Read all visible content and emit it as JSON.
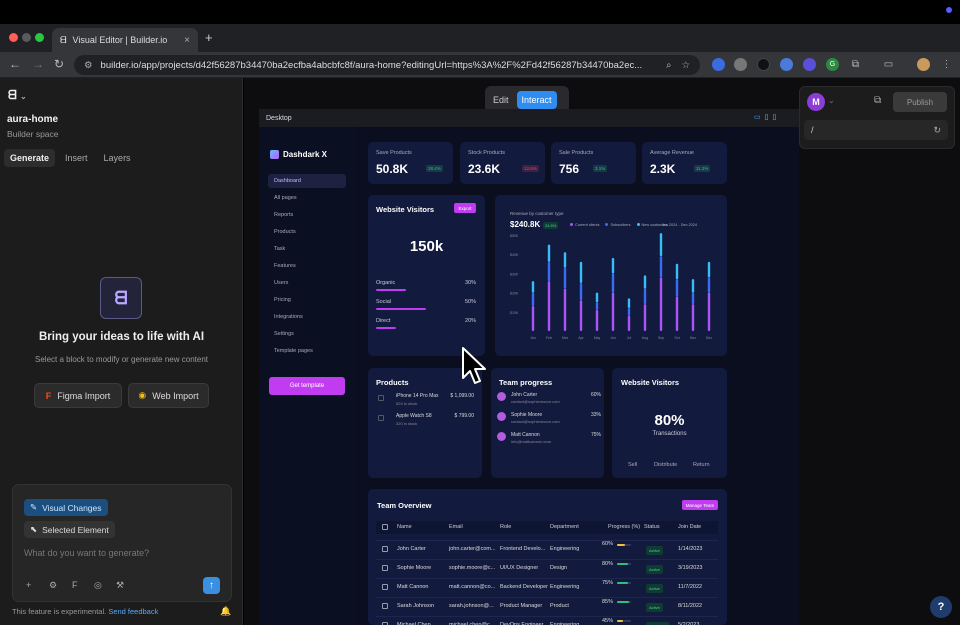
{
  "browser": {
    "tab_title": "Visual Editor | Builder.io",
    "tab_close": "×",
    "new_tab": "+",
    "url": "builder.io/app/projects/d42f56287b34470ba2ecfba4abcbfc8f/aura-home?editingUrl=https%3A%2F%2Fd42f56287b34470ba2ec...",
    "ext_labels": [
      "",
      "",
      "",
      "",
      "",
      "",
      "G",
      ""
    ]
  },
  "left_panel": {
    "project_name": "aura-home",
    "space_label": "Builder space",
    "tabs": [
      "Generate",
      "Insert",
      "Layers"
    ],
    "headline": "Bring your ideas to life with AI",
    "hint": "Select a block to modify or generate new content",
    "figma_import": "Figma Import",
    "web_import": "Web Import",
    "chip_visual": "Visual Changes",
    "chip_selected": "Selected Element",
    "prompt_placeholder": "What do you want to generate?",
    "experimental_text": "This feature is experimental.",
    "feedback_link": "Send feedback"
  },
  "editor": {
    "mode_edit": "Edit",
    "mode_interact": "Interact",
    "device_label": "Desktop",
    "avatar_letter": "M",
    "publish_label": "Publish",
    "path_value": "/",
    "help": "?"
  },
  "dashboard": {
    "brand": "Dashdark X",
    "nav": [
      "Dashboard",
      "All pages",
      "Reports",
      "Products",
      "Task",
      "Features",
      "Users",
      "Pricing",
      "Integrations",
      "Settings",
      "Template pages"
    ],
    "cta": "Get template",
    "stats": [
      {
        "label": "Save Products",
        "value": "50.8K",
        "badge": "28.4%",
        "color": "#2fbf7a"
      },
      {
        "label": "Stock Products",
        "value": "23.6K",
        "badge": "12.6%",
        "color": "#e0456a"
      },
      {
        "label": "Sale Products",
        "value": "756",
        "badge": "3.1%",
        "color": "#2fbf7a"
      },
      {
        "label": "Average Revenue",
        "value": "2.3K",
        "badge": "11.3%",
        "color": "#2fbf7a"
      }
    ],
    "visitors": {
      "title": "Website Visitors",
      "export": "Export",
      "total": "150k",
      "sources": [
        {
          "name": "Organic",
          "pct": "30%",
          "fill": 0.3
        },
        {
          "name": "Social",
          "pct": "50%",
          "fill": 0.5
        },
        {
          "name": "Direct",
          "pct": "20%",
          "fill": 0.2
        }
      ]
    },
    "revenue": {
      "subtitle": "Revenue by customer type",
      "total": "$240.8K",
      "badge": "24.6%",
      "legend": [
        "Current clients",
        "Subscribers",
        "New customers"
      ],
      "range": "Jan 2024 - Dec 2024"
    },
    "products": {
      "title": "Products",
      "items": [
        {
          "name": "iPhone 14 Pro Max",
          "price": "$ 1,099.00",
          "stock": "524 in stock"
        },
        {
          "name": "Apple Watch S8",
          "price": "$ 799.00",
          "stock": "320 in stock"
        }
      ]
    },
    "team_progress": {
      "title": "Team progress",
      "members": [
        {
          "name": "John Carter",
          "email": "contact@sophiemoore.com",
          "pct": "60%"
        },
        {
          "name": "Sophie Moore",
          "email": "contact@sophiemoore.com",
          "pct": "33%"
        },
        {
          "name": "Matt Cannon",
          "email": "info@mattcannon.com",
          "pct": "75%"
        }
      ]
    },
    "visitors2": {
      "title": "Website Visitors",
      "pct": "80%",
      "label": "Transactions",
      "tabs": [
        "Sell",
        "Distribute",
        "Return"
      ]
    },
    "team_overview": {
      "title": "Team Overview",
      "manage": "Manage Team",
      "columns": [
        "Name",
        "Email",
        "Role",
        "Department",
        "Progress (%)",
        "Status",
        "Join Date"
      ],
      "rows": [
        {
          "name": "John Carter",
          "email": "john.carter@com...",
          "role": "Frontend Develo...",
          "dept": "Engineering",
          "progress": "60%",
          "fill": 0.6,
          "status": "Active",
          "date": "1/14/2023",
          "color": "#f0c040"
        },
        {
          "name": "Sophie Moore",
          "email": "sophie.moore@c...",
          "role": "UI/UX Designer",
          "dept": "Design",
          "progress": "80%",
          "fill": 0.8,
          "status": "Active",
          "date": "3/19/2023",
          "color": "#2fbf7a"
        },
        {
          "name": "Matt Cannon",
          "email": "matt.cannon@co...",
          "role": "Backend Developer",
          "dept": "Engineering",
          "progress": "75%",
          "fill": 0.75,
          "status": "Active",
          "date": "11/7/2022",
          "color": "#2fbf7a"
        },
        {
          "name": "Sarah Johnson",
          "email": "sarah.johnson@...",
          "role": "Product Manager",
          "dept": "Product",
          "progress": "85%",
          "fill": 0.85,
          "status": "Active",
          "date": "8/11/2022",
          "color": "#2fbf7a"
        },
        {
          "name": "Michael Chen",
          "email": "michael.chen@c...",
          "role": "DevOps Engineer",
          "dept": "Engineering",
          "progress": "45%",
          "fill": 0.45,
          "status": "On Leave",
          "date": "5/2/2023",
          "color": "#f0c040"
        }
      ]
    }
  },
  "chart_data": {
    "type": "bar",
    "categories": [
      "Jan",
      "Feb",
      "Mar",
      "Apr",
      "May",
      "Jun",
      "Jul",
      "Aug",
      "Sep",
      "Oct",
      "Nov",
      "Dec"
    ],
    "yticks": [
      "$50K",
      "$40K",
      "$30K",
      "$20K",
      "$10K"
    ],
    "ylim": [
      0,
      50
    ],
    "series": [
      {
        "name": "Current clients",
        "values": [
          13,
          26,
          22,
          16,
          11,
          20,
          8,
          14,
          28,
          18,
          14,
          20
        ],
        "color": "#a855f7"
      },
      {
        "name": "Subscribers",
        "values": [
          7,
          10,
          11,
          9,
          4,
          10,
          4,
          8,
          11,
          9,
          6,
          8
        ],
        "color": "#3b6cf6"
      },
      {
        "name": "New customers",
        "values": [
          6,
          9,
          8,
          11,
          5,
          8,
          5,
          7,
          12,
          8,
          7,
          8
        ],
        "color": "#38bdf8"
      }
    ]
  }
}
